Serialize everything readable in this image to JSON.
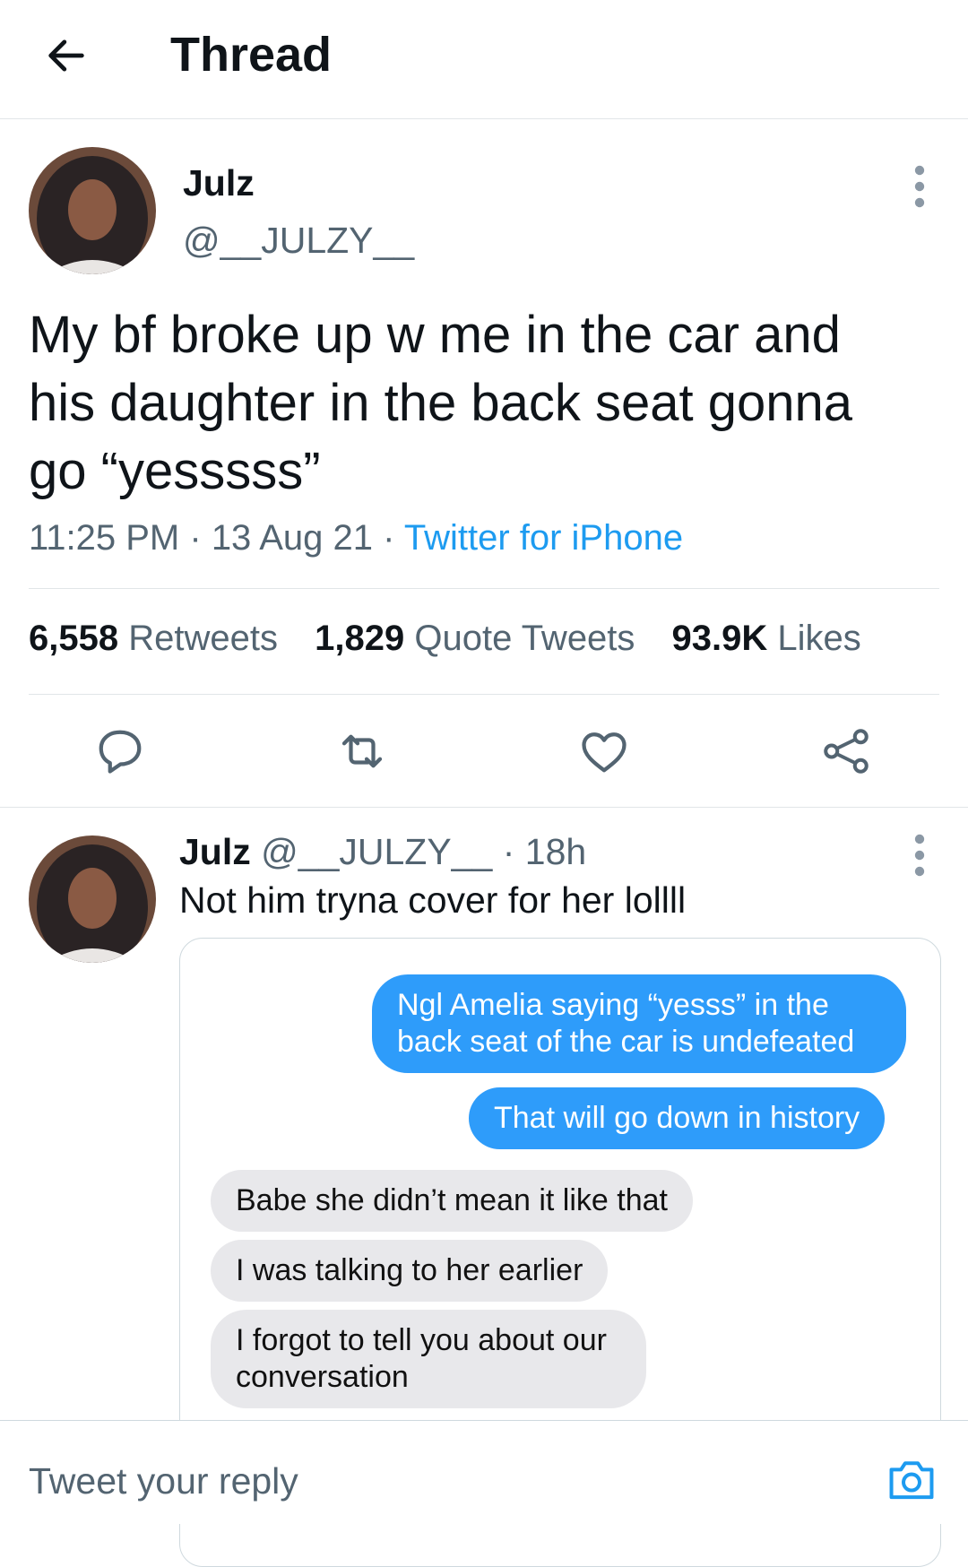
{
  "header": {
    "title": "Thread"
  },
  "main_tweet": {
    "name": "Julz",
    "handle": "@__JULZY__",
    "text": "My bf broke up w me in the car and his daughter in the back seat gonna go “yesssss”",
    "time": "11:25 PM",
    "date": "13 Aug 21",
    "source": "Twitter for iPhone"
  },
  "stats": {
    "retweets_count": "6,558",
    "retweets_label": "Retweets",
    "quotes_count": "1,829",
    "quotes_label": "Quote Tweets",
    "likes_count": "93.9K",
    "likes_label": "Likes"
  },
  "reply": {
    "name": "Julz",
    "handle": "@__JULZY__",
    "age": "18h",
    "text": "Not him tryna cover for her lollll",
    "messages": {
      "sent_1": "Ngl Amelia saying “yesss” in the back seat of the car is undefeated",
      "sent_2": "That will go down in history",
      "recv_1": "Babe she didn’t mean it like that",
      "recv_2": "I was talking to her earlier",
      "recv_3": "I forgot to tell you about our conversation"
    }
  },
  "reply_bar": {
    "placeholder": "Tweet your reply"
  },
  "colors": {
    "accent": "#1d9bf0",
    "sent_bubble": "#2e9cfa",
    "recv_bubble": "#e8e8eb",
    "secondary_text": "#536471"
  }
}
